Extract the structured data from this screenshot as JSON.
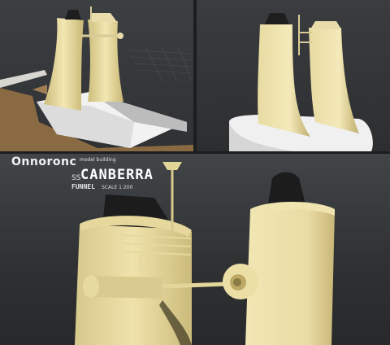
{
  "brand": {
    "name": "Onnoronc",
    "subtitle": "model building"
  },
  "title": {
    "prefix": "SS",
    "ship": "CANBERRA",
    "part": "FUNNEL",
    "scale": "SCALE 1:200"
  },
  "colors": {
    "funnel": "#e6d9a0",
    "hull": "#ededed",
    "deck": "#8a6a43",
    "background": "#2f3133"
  },
  "icons": {
    "logo": "onnoronc-logo"
  }
}
